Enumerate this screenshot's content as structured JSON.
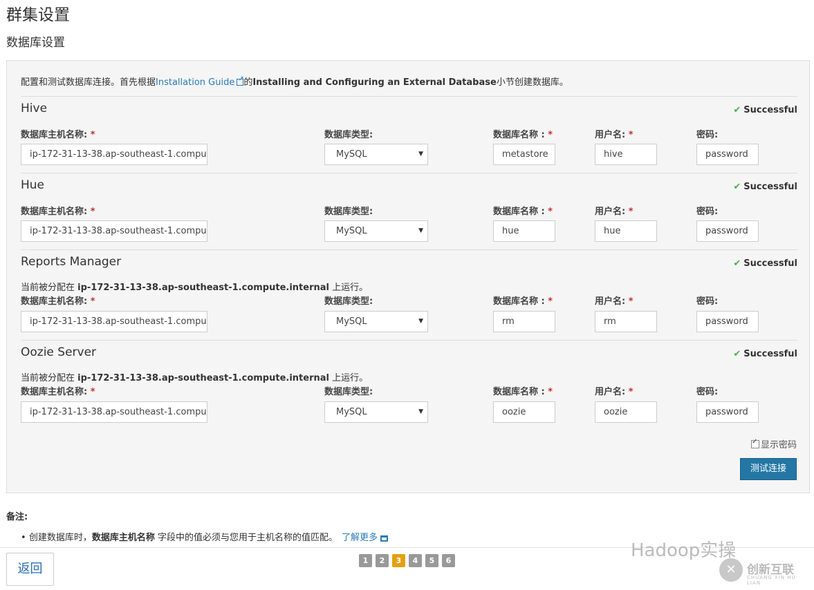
{
  "page_title": "群集设置",
  "section_title": "数据库设置",
  "intro": {
    "prefix": "配置和测试数据库连接。首先根据",
    "guide_link": "Installation Guide",
    "middle": "的",
    "bold": "Installing and Configuring an External Database",
    "suffix": "小节创建数据库。"
  },
  "labels": {
    "host": "数据库主机名称:",
    "type": "数据库类型:",
    "dbname": "数据库名称 :",
    "user": "用户名:",
    "password": "密码:",
    "required_mark": "*"
  },
  "services": [
    {
      "name": "Hive",
      "status": "Successful",
      "host": "ip-172-31-13-38.ap-southeast-1.comput",
      "type": "MySQL",
      "dbname": "metastore",
      "user": "hive",
      "password": "password"
    },
    {
      "name": "Hue",
      "status": "Successful",
      "host": "ip-172-31-13-38.ap-southeast-1.comput",
      "type": "MySQL",
      "dbname": "hue",
      "user": "hue",
      "password": "password"
    },
    {
      "name": "Reports Manager",
      "status": "Successful",
      "assigned_prefix": "当前被分配在 ",
      "assigned_host": "ip-172-31-13-38.ap-southeast-1.compute.internal",
      "assigned_suffix": " 上运行。",
      "host": "ip-172-31-13-38.ap-southeast-1.comput",
      "type": "MySQL",
      "dbname": "rm",
      "user": "rm",
      "password": "password"
    },
    {
      "name": "Oozie Server",
      "status": "Successful",
      "assigned_prefix": "当前被分配在 ",
      "assigned_host": "ip-172-31-13-38.ap-southeast-1.compute.internal",
      "assigned_suffix": " 上运行。",
      "host": "ip-172-31-13-38.ap-southeast-1.comput",
      "type": "MySQL",
      "dbname": "oozie",
      "user": "oozie",
      "password": "password"
    }
  ],
  "show_password_label": "显示密码",
  "test_button": "测试连接",
  "notes": {
    "title": "备注:",
    "item_prefix": "创建数据库时，",
    "item_bold": "数据库主机名称",
    "item_suffix": " 字段中的值必须与您用于主机名称的值匹配。",
    "learn_more": "了解更多"
  },
  "back_button": "返回",
  "steps": [
    "1",
    "2",
    "3",
    "4",
    "5",
    "6"
  ],
  "active_step": "3",
  "watermark": {
    "text1": "Hadoop实操",
    "brand": "创新互联",
    "brand_sub": "CHUANG XIN HU LIAN"
  },
  "colors": {
    "success": "#4cae4c",
    "primary": "#2476a5",
    "link": "#2a7ab8",
    "active_step": "#e5a010"
  }
}
